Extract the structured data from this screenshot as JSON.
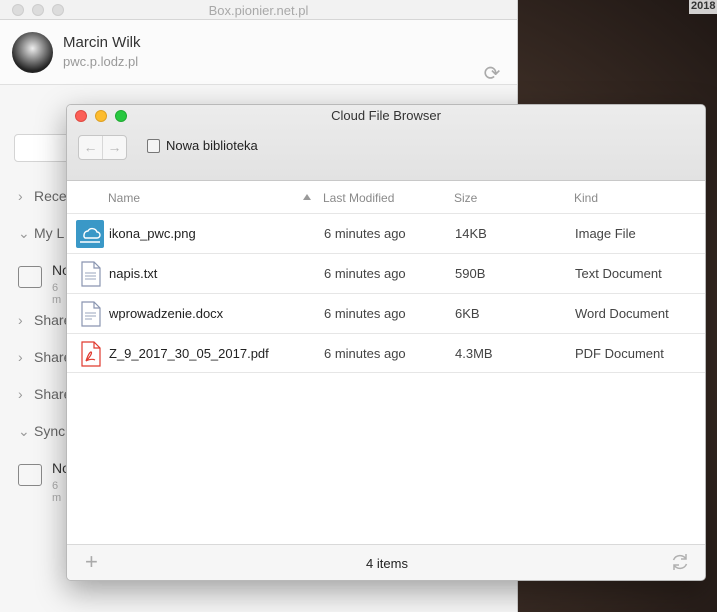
{
  "desktop": {
    "year_label": "2018"
  },
  "back_window": {
    "title": "Box.pionier.net.pl",
    "user_name": "Marcin Wilk",
    "user_host": "pwc.p.lodz.pl",
    "sections": [
      {
        "label": "Rece"
      },
      {
        "label": "My L"
      },
      {
        "label": "Share"
      },
      {
        "label": "Share"
      },
      {
        "label": "Share"
      },
      {
        "label": "Sync"
      }
    ],
    "libraries": [
      {
        "name": "No",
        "sub": "6 m"
      },
      {
        "name": "No",
        "sub": "6 m"
      }
    ]
  },
  "window": {
    "title": "Cloud File Browser",
    "nav_back": "←",
    "nav_forward": "→",
    "breadcrumb": "Nowa biblioteka"
  },
  "table": {
    "columns": {
      "name": "Name",
      "modified": "Last Modified",
      "size": "Size",
      "kind": "Kind"
    },
    "sort_column": "name",
    "rows": [
      {
        "name": "ikona_pwc.png",
        "modified": "6 minutes ago",
        "size": "14KB",
        "kind": "Image File",
        "icon": "image-icon"
      },
      {
        "name": "napis.txt",
        "modified": "6 minutes ago",
        "size": "590B",
        "kind": "Text Document",
        "icon": "text-file-icon"
      },
      {
        "name": "wprowadzenie.docx",
        "modified": "6 minutes ago",
        "size": "6KB",
        "kind": "Word Document",
        "icon": "word-file-icon"
      },
      {
        "name": "Z_9_2017_30_05_2017.pdf",
        "modified": "6 minutes ago",
        "size": "4.3MB",
        "kind": "PDF Document",
        "icon": "pdf-file-icon"
      }
    ]
  },
  "status": {
    "count_label": "4 items",
    "add_label": "+"
  },
  "colors": {
    "close": "#fc5f57",
    "minimize": "#fdbc2e",
    "maximize": "#28c840",
    "pdf_red": "#e03a2f",
    "image_blue": "#3a98c7"
  }
}
